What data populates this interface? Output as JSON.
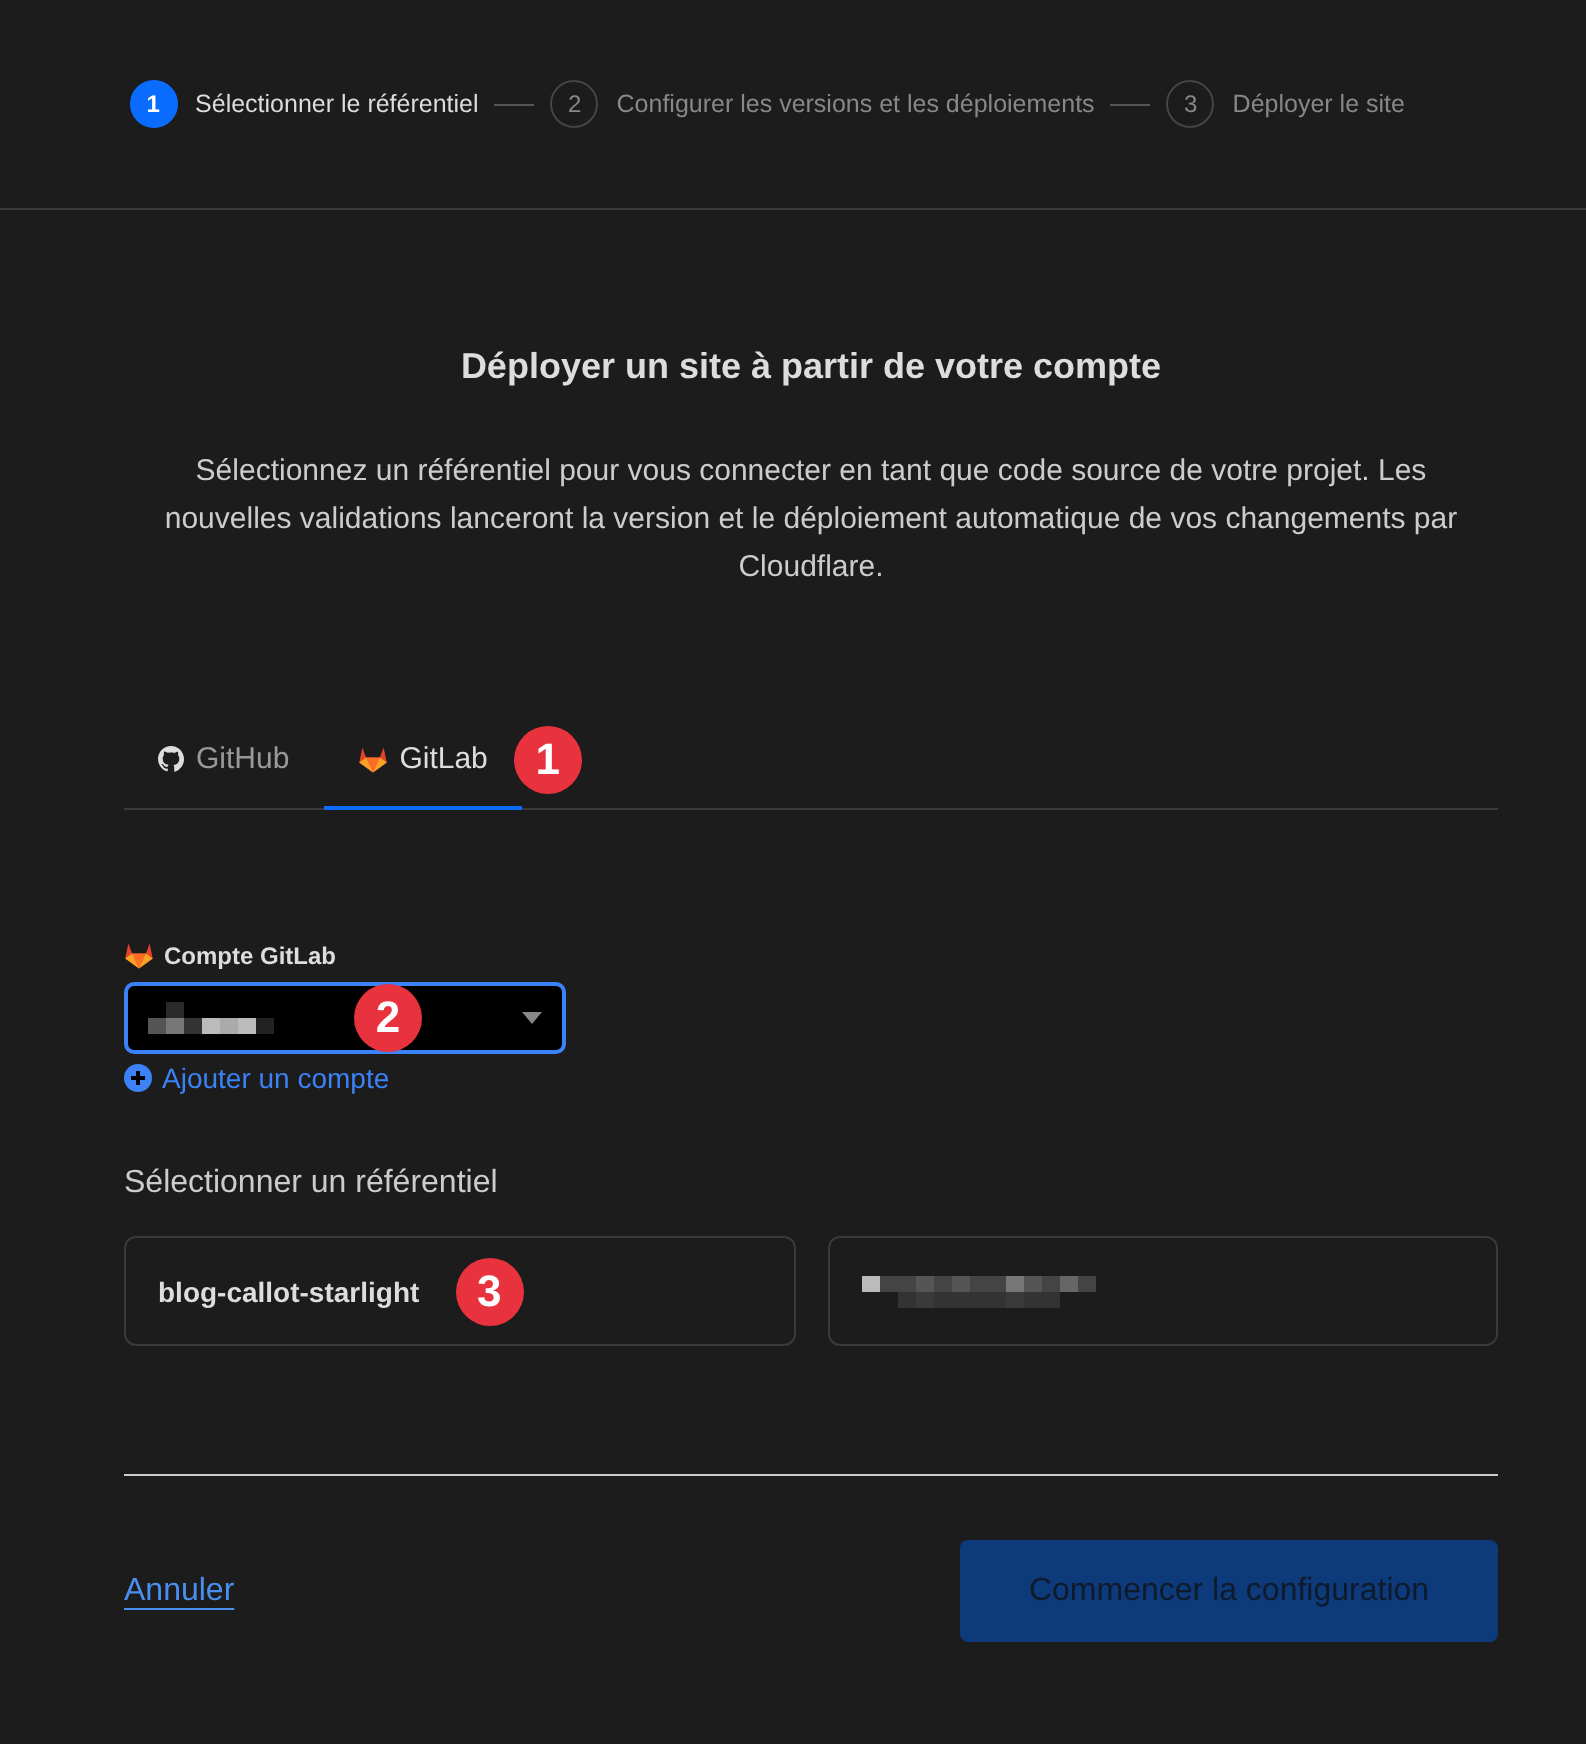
{
  "steps": [
    {
      "number": "1",
      "label": "Sélectionner le référentiel",
      "selected": true
    },
    {
      "number": "2",
      "label": "Configurer les versions et les déploiements",
      "selected": false
    },
    {
      "number": "3",
      "label": "Déployer le site",
      "selected": false
    }
  ],
  "title": "Déployer un site à partir de votre compte",
  "description": "Sélectionnez un référentiel pour vous connecter en tant que code source de votre projet. Les nouvelles validations lanceront la version et le déploiement automatique de vos changements par Cloudflare.",
  "tabs": [
    {
      "label": "GitHub",
      "kind": "github",
      "selected": false
    },
    {
      "label": "GitLab",
      "kind": "gitlab",
      "selected": true,
      "badge": "1"
    }
  ],
  "account": {
    "label": "Compte GitLab",
    "badge": "2",
    "add_link": "Ajouter un compte"
  },
  "repo_heading": "Sélectionner un référentiel",
  "repos": [
    {
      "name": "blog-callot-starlight",
      "badge": "3"
    },
    {
      "kind": "redacted"
    }
  ],
  "footer": {
    "cancel": "Annuler",
    "start": "Commencer la configuration"
  }
}
